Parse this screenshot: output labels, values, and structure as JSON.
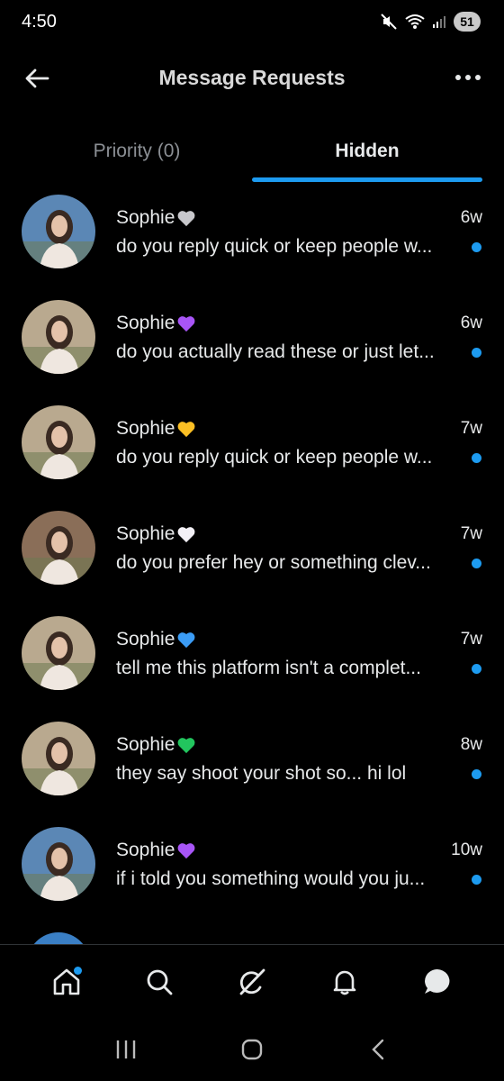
{
  "status_bar": {
    "time": "4:50",
    "battery": "51"
  },
  "header": {
    "title": "Message Requests"
  },
  "tabs": [
    {
      "label": "Priority (0)",
      "active": false
    },
    {
      "label": "Hidden",
      "active": true
    }
  ],
  "messages": [
    {
      "name": "Sophie",
      "heart": "grey-heart",
      "heart_color": "#c8c8cc",
      "time": "6w",
      "preview": "do you reply quick or keep people w...",
      "unread": true,
      "avatar_bg": "#5b87b5"
    },
    {
      "name": "Sophie",
      "heart": "purple-heart",
      "heart_color": "#a855f7",
      "time": "6w",
      "preview": "do you actually read these or just let...",
      "unread": true,
      "avatar_bg": "#b9a98f"
    },
    {
      "name": "Sophie",
      "heart": "yellow-heart",
      "heart_color": "#fbbf24",
      "time": "7w",
      "preview": "do you reply quick or keep people w...",
      "unread": true,
      "avatar_bg": "#b9a98f"
    },
    {
      "name": "Sophie",
      "heart": "white-heart",
      "heart_color": "#f3f0f6",
      "time": "7w",
      "preview": "do you prefer hey or something clev...",
      "unread": true,
      "avatar_bg": "#8a6e58"
    },
    {
      "name": "Sophie",
      "heart": "blue-heart",
      "heart_color": "#3b9cf5",
      "time": "7w",
      "preview": "tell me this platform isn't a complet...",
      "unread": true,
      "avatar_bg": "#b9a98f"
    },
    {
      "name": "Sophie",
      "heart": "green-heart",
      "heart_color": "#22c55e",
      "time": "8w",
      "preview": "they say shoot your shot so... hi lol",
      "unread": true,
      "avatar_bg": "#b9a98f"
    },
    {
      "name": "Sophie",
      "heart": "purple-heart",
      "heart_color": "#a855f7",
      "time": "10w",
      "preview": "if i told you something would you ju...",
      "unread": true,
      "avatar_bg": "#5b87b5"
    }
  ],
  "bottom_nav": [
    {
      "icon": "home-icon",
      "active": true,
      "badge": true
    },
    {
      "icon": "search-icon",
      "active": false,
      "badge": false
    },
    {
      "icon": "grok-icon",
      "active": false,
      "badge": false
    },
    {
      "icon": "bell-icon",
      "active": false,
      "badge": false
    },
    {
      "icon": "messages-icon",
      "active": true,
      "badge": false
    }
  ],
  "colors": {
    "accent": "#1d9bf0",
    "background": "#000000",
    "text": "#e7e9ea",
    "muted": "#8b8f94"
  }
}
